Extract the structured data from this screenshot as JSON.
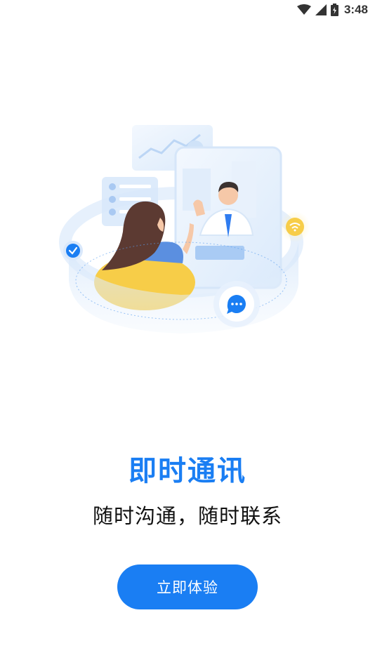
{
  "status_bar": {
    "time": "3:48",
    "icons": [
      "wifi-icon",
      "cell-signal-icon",
      "battery-icon"
    ]
  },
  "illustration": {
    "name": "video-chat-illustration",
    "icons": [
      "check-badge-icon",
      "wifi-badge-icon",
      "chat-bubble-icon"
    ]
  },
  "onboarding": {
    "title": "即时通讯",
    "subtitle": "随时沟通，随时联系",
    "cta_label": "立即体验"
  },
  "colors": {
    "primary": "#1a7ef3",
    "text": "#111111",
    "background": "#ffffff",
    "accent_yellow": "#f7cd48"
  }
}
